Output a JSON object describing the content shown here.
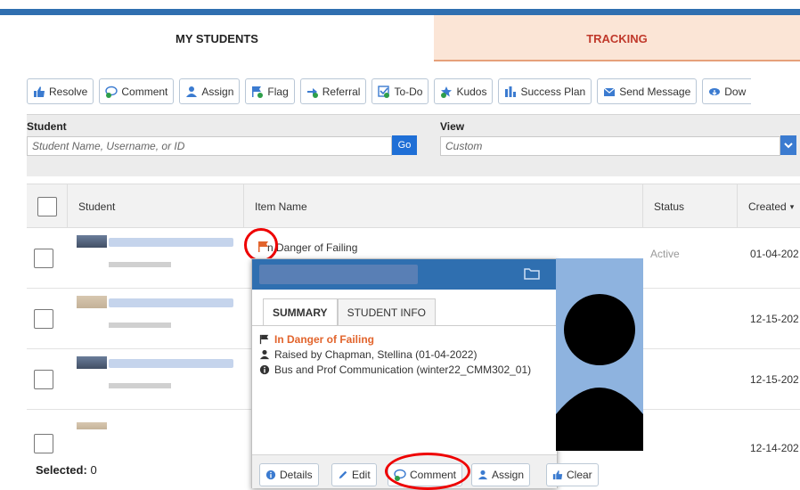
{
  "tabs": {
    "my_students": "MY STUDENTS",
    "tracking": "TRACKING"
  },
  "toolbar": {
    "resolve": "Resolve",
    "comment": "Comment",
    "assign": "Assign",
    "flag": "Flag",
    "referral": "Referral",
    "todo": "To-Do",
    "kudos": "Kudos",
    "success_plan": "Success Plan",
    "send_message": "Send Message",
    "download": "Dow"
  },
  "filters": {
    "student_label": "Student",
    "student_placeholder": "Student Name, Username, or ID",
    "go": "Go",
    "view_label": "View",
    "view_value": "Custom"
  },
  "table": {
    "headers": {
      "student": "Student",
      "item_name": "Item Name",
      "status": "Status",
      "created": "Created"
    },
    "row1": {
      "item": "n Danger of Failing",
      "status": "Active",
      "created": "01-04-202"
    },
    "row2": {
      "created": "12-15-202"
    },
    "row3": {
      "created": "12-15-202"
    },
    "row4": {
      "created": "12-14-202"
    }
  },
  "footer": {
    "selected_label": "Selected:",
    "selected_count": "0"
  },
  "popup": {
    "tab_summary": "SUMMARY",
    "tab_student_info": "STUDENT INFO",
    "flag_title": "In Danger of Failing",
    "raised_by": "Raised by Chapman, Stellina (01-04-2022)",
    "course": "Bus and Prof Communication (winter22_CMM302_01)",
    "btn_details": "Details",
    "btn_edit": "Edit",
    "btn_comment": "Comment",
    "btn_assign": "Assign",
    "btn_clear": "Clear"
  },
  "colors": {
    "accent": "#2f6fb0",
    "danger": "#e2642c",
    "tracking_bg": "#fbe5d6",
    "highlight_ring": "#e00000"
  }
}
